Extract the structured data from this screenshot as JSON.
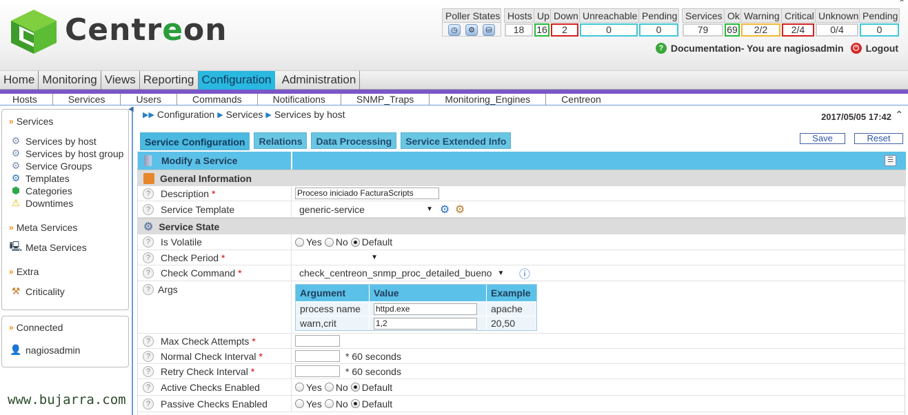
{
  "app": {
    "name_part1": "Centr",
    "name_part2": "e",
    "name_part3": "on"
  },
  "poller": {
    "label": "Poller States",
    "icons": [
      "clock-icon",
      "gear-icon",
      "database-icon"
    ]
  },
  "hosts_stats": {
    "headers": [
      "Hosts",
      "Up",
      "Down",
      "Unreachable",
      "Pending"
    ],
    "values": [
      "18",
      "16",
      "2",
      "0",
      "0"
    ],
    "colors": [
      "grey",
      "green",
      "red",
      "teal",
      "teal"
    ]
  },
  "services_stats": {
    "headers": [
      "Services",
      "Ok",
      "Warning",
      "Critical",
      "Unknown",
      "Pending"
    ],
    "values": [
      "79",
      "69",
      "2/2",
      "2/4",
      "0/4",
      "0"
    ],
    "colors": [
      "grey",
      "green",
      "yellow",
      "red",
      "grey",
      "teal"
    ]
  },
  "top_links": {
    "documentation": "Documentation",
    "you_are": " - You are nagiosadmin",
    "logout": "Logout"
  },
  "main_menu": [
    "Home",
    "Monitoring",
    "Views",
    "Reporting",
    "Configuration",
    "Administration"
  ],
  "main_menu_active": "Configuration",
  "sub_menu": [
    "Hosts",
    "Services",
    "Users",
    "Commands",
    "Notifications",
    "SNMP_Traps",
    "Monitoring_Engines",
    "Centreon"
  ],
  "sidebar": {
    "services_heading": "Services",
    "services_items": [
      "Services by host",
      "Services by host group",
      "Service Groups",
      "Templates",
      "Categories",
      "Downtimes"
    ],
    "meta_heading": "Meta Services",
    "meta_items": [
      "Meta Services"
    ],
    "extra_heading": "Extra",
    "extra_items": [
      "Criticality"
    ],
    "connected_heading": "Connected",
    "connected_user": "nagiosadmin"
  },
  "watermark": "www.bujarra.com",
  "breadcrumb": [
    "Configuration",
    "Services",
    "Services by host"
  ],
  "datetime": "2017/05/05 17:42",
  "tabs": [
    "Service Configuration",
    "Relations",
    "Data Processing",
    "Service Extended Info"
  ],
  "buttons": {
    "save": "Save",
    "reset": "Reset"
  },
  "form": {
    "title": "Modify a Service",
    "general_section": "General Information",
    "description_label": "Description",
    "description_value": "Proceso iniciado FacturaScripts",
    "template_label": "Service Template",
    "template_value": "generic-service",
    "state_section": "Service State",
    "volatile_label": "Is Volatile",
    "check_period_label": "Check Period",
    "check_period_value": "",
    "check_command_label": "Check Command",
    "check_command_value": "check_centreon_snmp_proc_detailed_bueno",
    "args_label": "Args",
    "args": {
      "headers": [
        "Argument",
        "Value",
        "Example"
      ],
      "rows": [
        {
          "argument": "process name",
          "value": "httpd.exe",
          "example": "apache"
        },
        {
          "argument": "warn,crit",
          "value": "1,2",
          "example": "20,50"
        }
      ]
    },
    "max_attempts_label": "Max Check Attempts",
    "max_attempts_value": "",
    "normal_interval_label": "Normal Check Interval",
    "normal_interval_value": "",
    "retry_interval_label": "Retry Check Interval",
    "retry_interval_value": "",
    "interval_unit": "* 60 seconds",
    "active_checks_label": "Active Checks Enabled",
    "passive_checks_label": "Passive Checks Enabled",
    "radio_yes": "Yes",
    "radio_no": "No",
    "radio_default": "Default"
  }
}
